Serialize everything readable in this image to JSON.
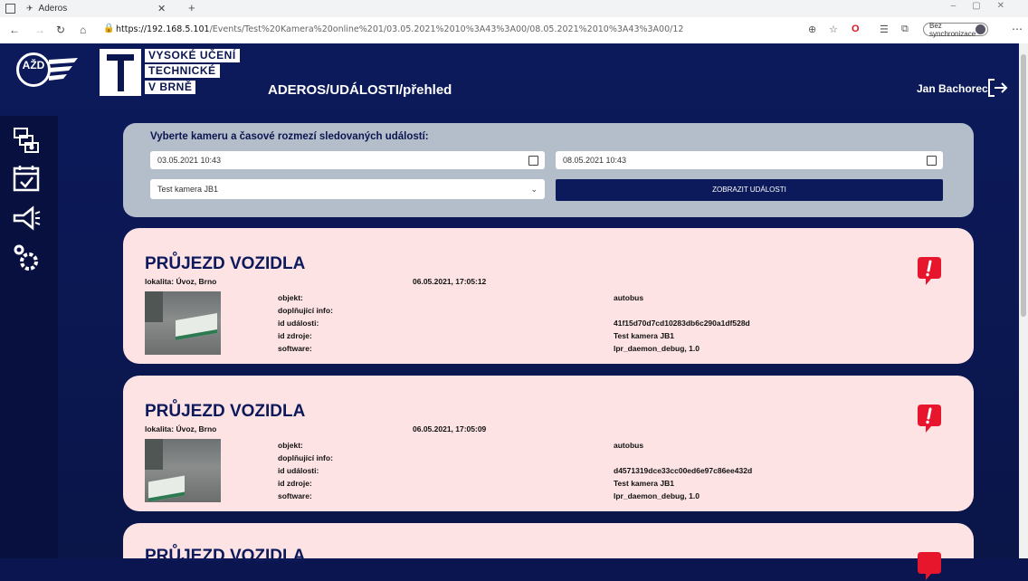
{
  "browser": {
    "tab_title": "Aderos",
    "new_tab": "+",
    "url_host": "https://192.168.5.101",
    "url_path": "/Events/Test%20Kamera%20online%201/03.05.2021%2010%3A43%3A00/08.05.2021%2010%3A43%3A00/12",
    "sync_label": "Bez synchronizace"
  },
  "header": {
    "logo_text": "AŽD",
    "vut_lines": [
      "VYSOKÉ UČENÍ",
      "TECHNICKÉ",
      "V BRNĚ"
    ],
    "page_title": "ADEROS/UDÁLOSTI/přehled",
    "user_name": "Jan Bachorec"
  },
  "sidebar": {
    "icons": [
      "cameras-icon",
      "calendar-check-icon",
      "megaphone-icon",
      "settings-gears-icon"
    ]
  },
  "filter": {
    "title": "Vyberte kameru a časové rozmezí sledovaných událostí:",
    "date_from": "03.05.2021 10:43",
    "date_to": "08.05.2021 10:43",
    "camera": "Test kamera JB1",
    "submit_label": "ZOBRAZIT UDÁLOSTI"
  },
  "events": [
    {
      "title": "PRŮJEZD VOZIDLA",
      "location": "lokalita: Úvoz, Brno",
      "datetime": "06.05.2021, 17:05:12",
      "labels": [
        "objekt:",
        "doplňující info:",
        "id události:",
        "id zdroje:",
        "software:"
      ],
      "values": [
        "autobus",
        "",
        "41f15d70d7cd10283db6c290a1df528d",
        "Test kamera JB1",
        "lpr_daemon_debug, 1.0"
      ]
    },
    {
      "title": "PRŮJEZD VOZIDLA",
      "location": "lokalita: Úvoz, Brno",
      "datetime": "06.05.2021, 17:05:09",
      "labels": [
        "objekt:",
        "doplňující info:",
        "id události:",
        "id zdroje:",
        "software:"
      ],
      "values": [
        "autobus",
        "",
        "d4571319dce33cc00ed6e97c86ee432d",
        "Test kamera JB1",
        "lpr_daemon_debug, 1.0"
      ]
    },
    {
      "title": "PRŮJEZD VOZIDLA"
    }
  ],
  "colors": {
    "navy": "#0c1a5c",
    "card_bg": "#fde3e4",
    "panel_bg": "#b4bdca",
    "alert_red": "#e8162c"
  }
}
